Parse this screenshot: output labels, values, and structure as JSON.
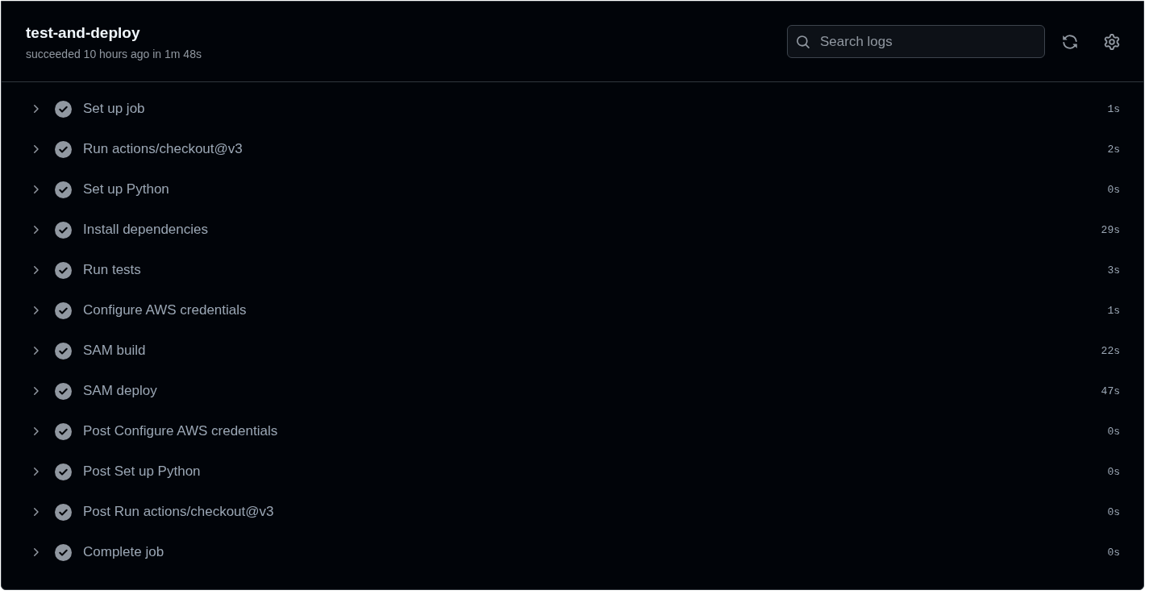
{
  "job": {
    "title": "test-and-deploy",
    "summary": "succeeded 10 hours ago in 1m 48s"
  },
  "search": {
    "placeholder": "Search logs"
  },
  "toolbar": [
    {
      "kind": "refresh"
    },
    {
      "kind": "settings"
    }
  ],
  "steps": [
    {
      "name": "Set up job",
      "succeeded": true,
      "expanded": false,
      "duration": "1s"
    },
    {
      "name": "Run actions/checkout@v3",
      "succeeded": true,
      "expanded": false,
      "duration": "2s"
    },
    {
      "name": "Set up Python",
      "succeeded": true,
      "expanded": false,
      "duration": "0s"
    },
    {
      "name": "Install dependencies",
      "succeeded": true,
      "expanded": false,
      "duration": "29s"
    },
    {
      "name": "Run tests",
      "succeeded": true,
      "expanded": false,
      "duration": "3s"
    },
    {
      "name": "Configure AWS credentials",
      "succeeded": true,
      "expanded": false,
      "duration": "1s"
    },
    {
      "name": "SAM build",
      "succeeded": true,
      "expanded": false,
      "duration": "22s"
    },
    {
      "name": "SAM deploy",
      "succeeded": true,
      "expanded": false,
      "duration": "47s"
    },
    {
      "name": "Post Configure AWS credentials",
      "succeeded": true,
      "expanded": false,
      "duration": "0s"
    },
    {
      "name": "Post Set up Python",
      "succeeded": true,
      "expanded": false,
      "duration": "0s"
    },
    {
      "name": "Post Run actions/checkout@v3",
      "succeeded": true,
      "expanded": false,
      "duration": "0s"
    },
    {
      "name": "Complete job",
      "succeeded": true,
      "expanded": false,
      "duration": "0s"
    }
  ]
}
